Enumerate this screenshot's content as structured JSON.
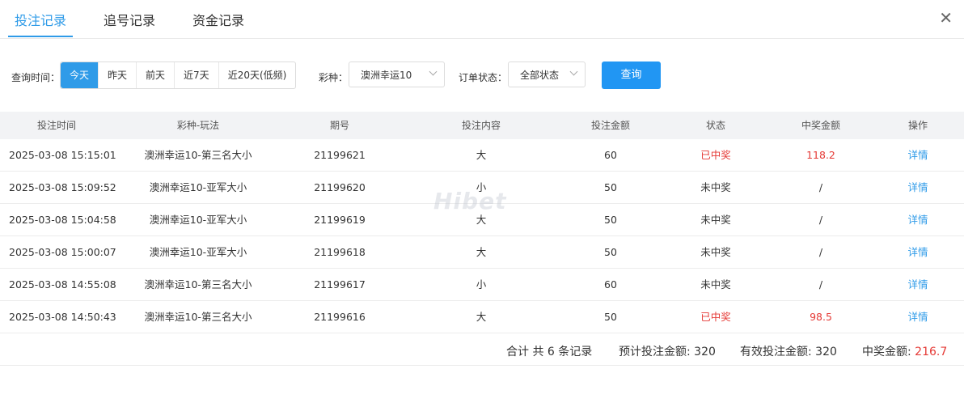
{
  "tabs": [
    "投注记录",
    "追号记录",
    "资金记录"
  ],
  "close": "✕",
  "filter": {
    "time_label": "查询时间：",
    "days": [
      "今天",
      "昨天",
      "前天",
      "近7天",
      "近20天(低频)"
    ],
    "lottery_label": "彩种：",
    "lottery_value": "澳洲幸运10",
    "status_label": "订单状态：",
    "status_value": "全部状态",
    "query_button": "查询"
  },
  "table": {
    "headers": [
      "投注时间",
      "彩种-玩法",
      "期号",
      "投注内容",
      "投注金额",
      "状态",
      "中奖金额",
      "操作"
    ],
    "rows": [
      {
        "time": "2025-03-08 15:15:01",
        "game": "澳洲幸运10-第三名大小",
        "issue": "21199621",
        "content": "大",
        "amount": "60",
        "status": "已中奖",
        "prize": "118.2",
        "action": "详情"
      },
      {
        "time": "2025-03-08 15:09:52",
        "game": "澳洲幸运10-亚军大小",
        "issue": "21199620",
        "content": "小",
        "amount": "50",
        "status": "未中奖",
        "prize": "/",
        "action": "详情"
      },
      {
        "time": "2025-03-08 15:04:58",
        "game": "澳洲幸运10-亚军大小",
        "issue": "21199619",
        "content": "大",
        "amount": "50",
        "status": "未中奖",
        "prize": "/",
        "action": "详情"
      },
      {
        "time": "2025-03-08 15:00:07",
        "game": "澳洲幸运10-亚军大小",
        "issue": "21199618",
        "content": "大",
        "amount": "50",
        "status": "未中奖",
        "prize": "/",
        "action": "详情"
      },
      {
        "time": "2025-03-08 14:55:08",
        "game": "澳洲幸运10-第三名大小",
        "issue": "21199617",
        "content": "小",
        "amount": "60",
        "status": "未中奖",
        "prize": "/",
        "action": "详情"
      },
      {
        "time": "2025-03-08 14:50:43",
        "game": "澳洲幸运10-第三名大小",
        "issue": "21199616",
        "content": "大",
        "amount": "50",
        "status": "已中奖",
        "prize": "98.5",
        "action": "详情"
      }
    ]
  },
  "summary": {
    "count": "合计 共 6 条记录",
    "expected_label": "预计投注金额: ",
    "expected_value": "320",
    "valid_label": "有效投注金额: ",
    "valid_value": "320",
    "prize_label": "中奖金额: ",
    "prize_value": "216.7"
  },
  "watermark": "Hibet",
  "colors": {
    "accent": "#2f9be8",
    "win": "#e53935"
  }
}
